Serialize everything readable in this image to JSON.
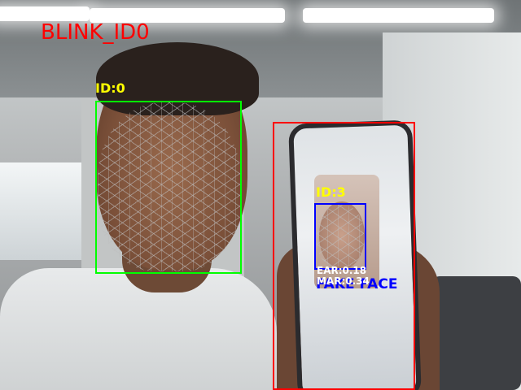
{
  "status_title": "BLINK_ID0",
  "detections": {
    "person0": {
      "id_label": "ID:0"
    },
    "person3": {
      "id_label": "ID:3",
      "ear_label": "EAR:0.18",
      "mar_label": "MAR:0.34",
      "verdict": "FAKE FACE"
    }
  },
  "colors": {
    "title": "#ff0000",
    "real_box": "#00ff00",
    "fake_outer_box": "#ff0000",
    "fake_face_box": "#0000ff",
    "id_text": "#ffff00",
    "metric_text": "#ffffff",
    "verdict_text": "#0000ff"
  }
}
